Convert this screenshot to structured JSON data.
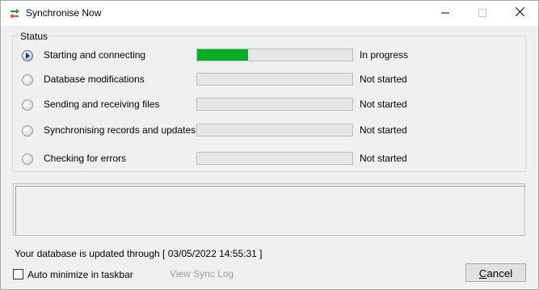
{
  "window": {
    "title": "Synchronise Now"
  },
  "status_group": {
    "label": "Status"
  },
  "steps": [
    {
      "label": "Starting and connecting",
      "status": "In progress",
      "progress": 0.33,
      "active": true
    },
    {
      "label": "Database modifications",
      "status": "Not started",
      "progress": 0
    },
    {
      "label": "Sending and receiving files",
      "status": "Not started",
      "progress": 0
    },
    {
      "label": "Synchronising records and updates",
      "status": "Not started",
      "progress": 0
    },
    {
      "label": "Checking for errors",
      "status": "Not started",
      "progress": 0
    }
  ],
  "log": {
    "text": ""
  },
  "footer": {
    "updated_text": "Your database is updated through [ 03/05/2022 14:55:31 ]",
    "auto_minimize_label": "Auto minimize in taskbar",
    "auto_minimize_checked": false,
    "view_log_label": "View Sync Log",
    "cancel_label": "Cancel"
  },
  "colors": {
    "progress_fill": "#06b025",
    "disabled_text": "#9d9d9d"
  },
  "icons": {
    "app": "sync-arrows-icon",
    "active_step": "arrow-right-icon"
  }
}
